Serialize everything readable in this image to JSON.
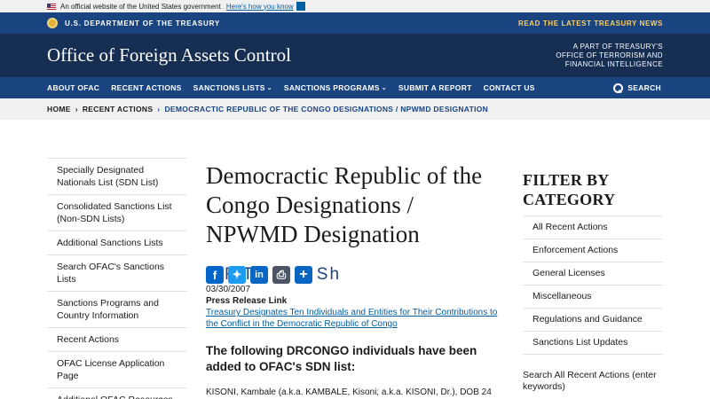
{
  "gov_banner": {
    "text": "An official website of the United States government",
    "link": "Here's how you know"
  },
  "treasury_bar": {
    "name": "U.S. DEPARTMENT OF THE TREASURY",
    "news_link": "READ THE LATEST TREASURY NEWS"
  },
  "header": {
    "title": "Office of Foreign Assets Control",
    "part_of": [
      "A PART OF TREASURY'S",
      "OFFICE OF TERRORISM AND",
      "FINANCIAL INTELLIGENCE"
    ]
  },
  "nav": {
    "items": [
      {
        "label": "ABOUT OFAC",
        "dropdown": false
      },
      {
        "label": "RECENT ACTIONS",
        "dropdown": false
      },
      {
        "label": "SANCTIONS LISTS",
        "dropdown": true
      },
      {
        "label": "SANCTIONS PROGRAMS",
        "dropdown": true
      },
      {
        "label": "SUBMIT A REPORT",
        "dropdown": false
      },
      {
        "label": "CONTACT US",
        "dropdown": false
      }
    ],
    "search_label": "SEARCH"
  },
  "breadcrumb": {
    "home": "HOME",
    "parent": "RECENT ACTIONS",
    "current": "DEMOCRACTIC REPUBLIC OF THE CONGO DESIGNATIONS / NPWMD DESIGNATION"
  },
  "sidebar": {
    "items": [
      "Specially Designated Nationals List (SDN List)",
      "Consolidated Sanctions List (Non-SDN Lists)",
      "Additional Sanctions Lists",
      "Search OFAC's Sanctions Lists",
      "Sanctions Programs and Country Information",
      "Recent Actions",
      "OFAC License Application Page",
      "Additional OFAC Resources"
    ]
  },
  "content": {
    "title": "Democractic Republic of the Congo Designations / NPWMD Designation",
    "share_overlap_text": "F Tw Li P Sh",
    "date": "03/30/2007",
    "press_label": "Press Release Link",
    "press_link": "Treasury Designates Ten Individuals and Entities for Their Contributions to the Conflict in the Democratic Republic of Congo",
    "sub_heading": "The following DRCONGO individuals have been added to OFAC's SDN list:",
    "body_snippet": "KISONI, Kambale (a.k.a. KAMBALE, Kisoni; a.k.a. KISONI, Dr.), DOB 24"
  },
  "filter": {
    "title": "FILTER BY CATEGORY",
    "items": [
      "All Recent Actions",
      "Enforcement Actions",
      "General Licenses",
      "Miscellaneous",
      "Regulations and Guidance",
      "Sanctions List Updates"
    ],
    "search_label": "Search All Recent Actions (enter keywords)"
  }
}
